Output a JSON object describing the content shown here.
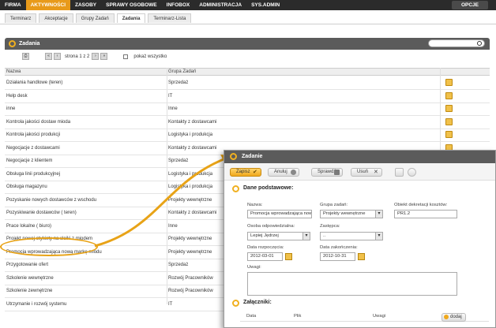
{
  "topnav": {
    "items": [
      "FIRMA",
      "AKTYWNOŚCI",
      "ZASOBY",
      "SPRAWY OSOBOWE",
      "INFOBOX",
      "ADMINISTRACJA",
      "SYS.ADMIN"
    ],
    "options_label": "OPCJE"
  },
  "subtabs": [
    "Terminarz",
    "Akceptacje",
    "Grupy Zadań",
    "Zadania",
    "Terminarz-Lista"
  ],
  "panel": {
    "title": "Zadania"
  },
  "pager": {
    "page_text": "strona 1 z 2",
    "show_all_label": "pokaż wszystko"
  },
  "table": {
    "headers": [
      "Nazwa",
      "Grupa Zadań"
    ],
    "rows": [
      [
        "Działania handlowe (teren)",
        "Sprzedaż"
      ],
      [
        "Help desk",
        "IT"
      ],
      [
        "inne",
        "Inne"
      ],
      [
        "Kontrola jakości dostaw mioda",
        "Kontakty z dostawcami"
      ],
      [
        "Kontrola jakości produkcji",
        "Logistyka i produkcja"
      ],
      [
        "Negocjacje z dostawcami",
        "Kontakty z dostawcami"
      ],
      [
        "Negocjacje z klientem",
        "Sprzedaż"
      ],
      [
        "Obsługa linii produkcyjnej",
        "Logistyka i produkcja"
      ],
      [
        "Obsługa magazynu",
        "Logistyka i produkcja"
      ],
      [
        "Pozyskanie nowych dostawców z wschodu",
        "Projekty wewnętrzne"
      ],
      [
        "Pozyskiwanie dostawców ( teren)",
        "Kontakty z dostawcami"
      ],
      [
        "Prace lokalne ( biuro)",
        "Inne"
      ],
      [
        "Projekt nowej etykiety na słoiki z miodem",
        "Projekty wewnętrzne"
      ],
      [
        "Promocja wprowadzająca nową markę miodu",
        "Projekty wewnętrzne"
      ],
      [
        "Przygotowanie ofert",
        "Sprzedaż"
      ],
      [
        "Szkolenie wewnętrzne",
        "Rozwój Pracowników"
      ],
      [
        "Szkolenie zewnętrzne",
        "Rozwój Pracowników"
      ],
      [
        "Utrzymanie i rozwój systemu",
        "IT"
      ]
    ]
  },
  "dialog": {
    "title": "Zadanie",
    "buttons": {
      "save": "Zapisz",
      "cancel": "Anuluj",
      "check": "Sprawdź",
      "delete": "Usuń"
    },
    "section_basic": "Dane podstawowe:",
    "labels": {
      "name": "Nazwa:",
      "group": "Grupa zadań:",
      "cost": "Obiekt dekretacji kosztów:",
      "person": "Osoba odpowiedzialna:",
      "deputy": "Zastępca:",
      "start": "Data rozpoczęcia:",
      "end": "Data zakończenia:",
      "notes": "Uwagi:"
    },
    "values": {
      "name": "Promocja wprowadzająca now",
      "group": "Projekty wewnętrzne",
      "cost": "PR1.2",
      "person": "Lepiej Jędrzej",
      "deputy": "..",
      "start": "2012-03-01",
      "end": "2012-10-31"
    },
    "section_attachments": "Załączniki:",
    "att_headers": [
      "Data",
      "Plik",
      "Uwagi"
    ],
    "add_label": "dodaj"
  }
}
